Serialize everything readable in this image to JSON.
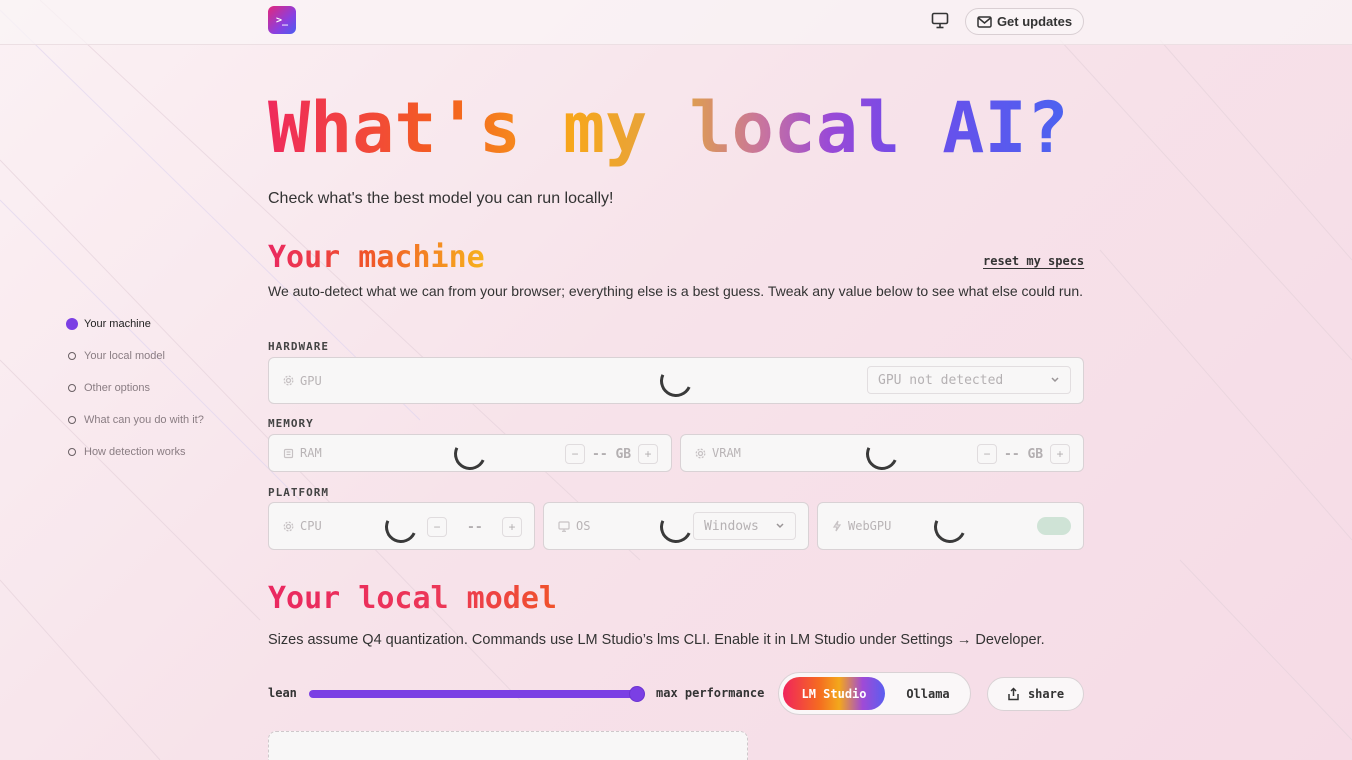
{
  "header": {
    "logo_text": ">_",
    "updates_label": "Get updates",
    "icons": [
      "monitor-icon",
      "mail-icon"
    ]
  },
  "sidenav": {
    "items": [
      {
        "label": "Your machine",
        "active": true
      },
      {
        "label": "Your local model",
        "active": false
      },
      {
        "label": "Other options",
        "active": false
      },
      {
        "label": "What can you do with it?",
        "active": false
      },
      {
        "label": "How detection works",
        "active": false
      }
    ]
  },
  "hero": {
    "title": "What's my local AI?",
    "subtitle": "Check what's the best model you can run locally!"
  },
  "machine": {
    "heading": "Your machine",
    "reset_label": "reset my specs",
    "description": "We auto-detect what we can from your browser; everything else is a best guess. Tweak any value below to see what else could run.",
    "hardware_label": "HARDWARE",
    "gpu": {
      "label": "GPU",
      "selected": "GPU not detected"
    },
    "memory_label": "MEMORY",
    "ram": {
      "label": "RAM",
      "value": "-- GB",
      "minus": "−",
      "plus": "+"
    },
    "vram": {
      "label": "VRAM",
      "value": "-- GB",
      "minus": "−",
      "plus": "+"
    },
    "platform_label": "PLATFORM",
    "cpu": {
      "label": "CPU",
      "value": "--",
      "minus": "−",
      "plus": "+"
    },
    "os": {
      "label": "OS",
      "selected": "Windows"
    },
    "webgpu": {
      "label": "WebGPU",
      "enabled": false
    }
  },
  "model": {
    "heading": "Your local model",
    "description": "Sizes assume Q4 quantization. Commands use LM Studio’s lms CLI. Enable it in LM Studio under Settings → Developer.",
    "slider": {
      "min_label": "lean",
      "max_label": "max performance",
      "value_fraction": 1.0
    },
    "runtime_options": [
      "LM Studio",
      "Ollama"
    ],
    "runtime_selected": "LM Studio",
    "share_label": "share"
  },
  "colors": {
    "accent": "#7b3fe4",
    "title_start": "#ef2a5c",
    "title_end": "#4b63f0"
  }
}
